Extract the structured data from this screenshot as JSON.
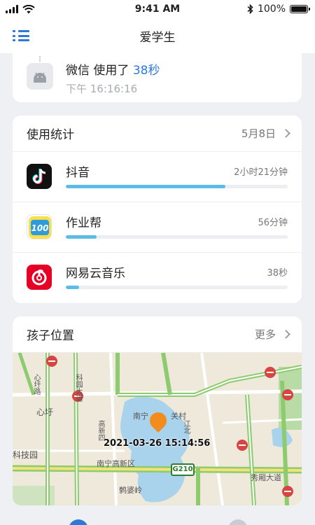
{
  "status_bar": {
    "time": "9:41 AM",
    "battery": "100%",
    "bluetooth_icon": "bluetooth-icon",
    "wifi_icon": "wifi-icon"
  },
  "nav": {
    "title": "爱学生",
    "menu_icon": "menu-icon"
  },
  "notification": {
    "app": "微信",
    "text": "使用了",
    "duration": "38秒",
    "time": "下午 16:16:16",
    "icon": "android-icon"
  },
  "usage": {
    "title": "使用统计",
    "date": "5月8日",
    "apps": [
      {
        "name": "抖音",
        "time": "2小时21分钟",
        "progress": 0.72,
        "icon": "douyin-icon"
      },
      {
        "name": "作业帮",
        "time": "56分钟",
        "progress": 0.14,
        "icon": "zuoyebang-icon"
      },
      {
        "name": "网易云音乐",
        "time": "38秒",
        "progress": 0.06,
        "icon": "netease-music-icon"
      }
    ]
  },
  "location": {
    "title": "孩子位置",
    "more": "更多",
    "timestamp": "2021-03-26 15:14:56",
    "map_labels": {
      "l1": "南宁",
      "l2": "关村",
      "l3": "心圩",
      "l4": "科技园",
      "l5": "南宁高新区",
      "l6": "秀厢大道",
      "l7": "鹩婆岭",
      "l8": "科园大道",
      "l9": "高新四",
      "l10": "心圩路",
      "l11": "江北"
    },
    "route": "G210"
  },
  "colors": {
    "accent": "#2d78d8",
    "progress": "#5bbde6",
    "pin": "#f28c1f"
  }
}
